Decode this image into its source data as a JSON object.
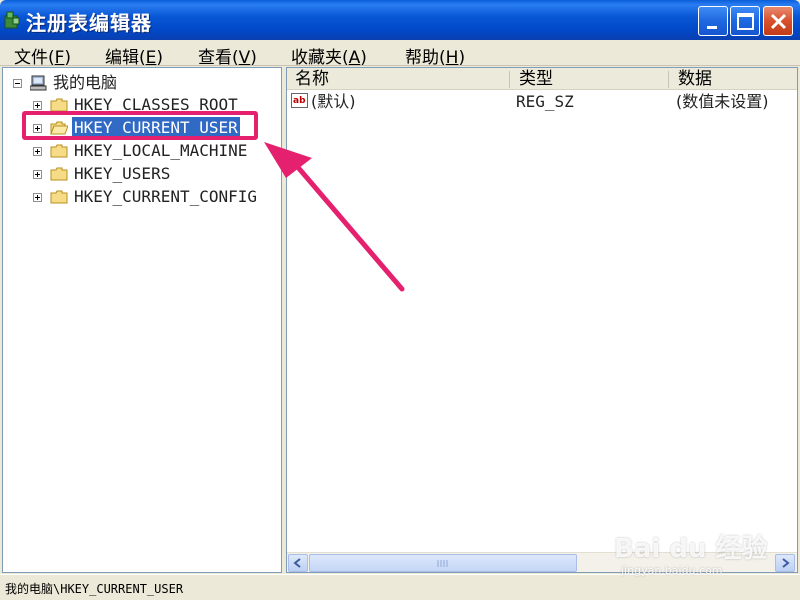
{
  "window": {
    "title": "注册表编辑器",
    "icon": "registry-icon"
  },
  "menu": [
    {
      "label": "文件",
      "accel": "F"
    },
    {
      "label": "编辑",
      "accel": "E"
    },
    {
      "label": "查看",
      "accel": "V"
    },
    {
      "label": "收藏夹",
      "accel": "A"
    },
    {
      "label": "帮助",
      "accel": "H"
    }
  ],
  "tree": {
    "root_label": "我的电脑",
    "items": [
      {
        "label": "HKEY_CLASSES_ROOT",
        "selected": false
      },
      {
        "label": "HKEY_CURRENT_USER",
        "selected": true
      },
      {
        "label": "HKEY_LOCAL_MACHINE",
        "selected": false
      },
      {
        "label": "HKEY_USERS",
        "selected": false
      },
      {
        "label": "HKEY_CURRENT_CONFIG",
        "selected": false
      }
    ]
  },
  "list": {
    "columns": [
      "名称",
      "类型",
      "数据"
    ],
    "rows": [
      {
        "name": "(默认)",
        "type": "REG_SZ",
        "data": "(数值未设置)",
        "icon": "string-value-icon"
      }
    ]
  },
  "status": {
    "path": "我的电脑\\HKEY_CURRENT_USER"
  },
  "annotation": {
    "color": "#e5216f"
  },
  "watermark": {
    "brand": "Bai du 经验",
    "url": "jingyan.baidu.com"
  }
}
